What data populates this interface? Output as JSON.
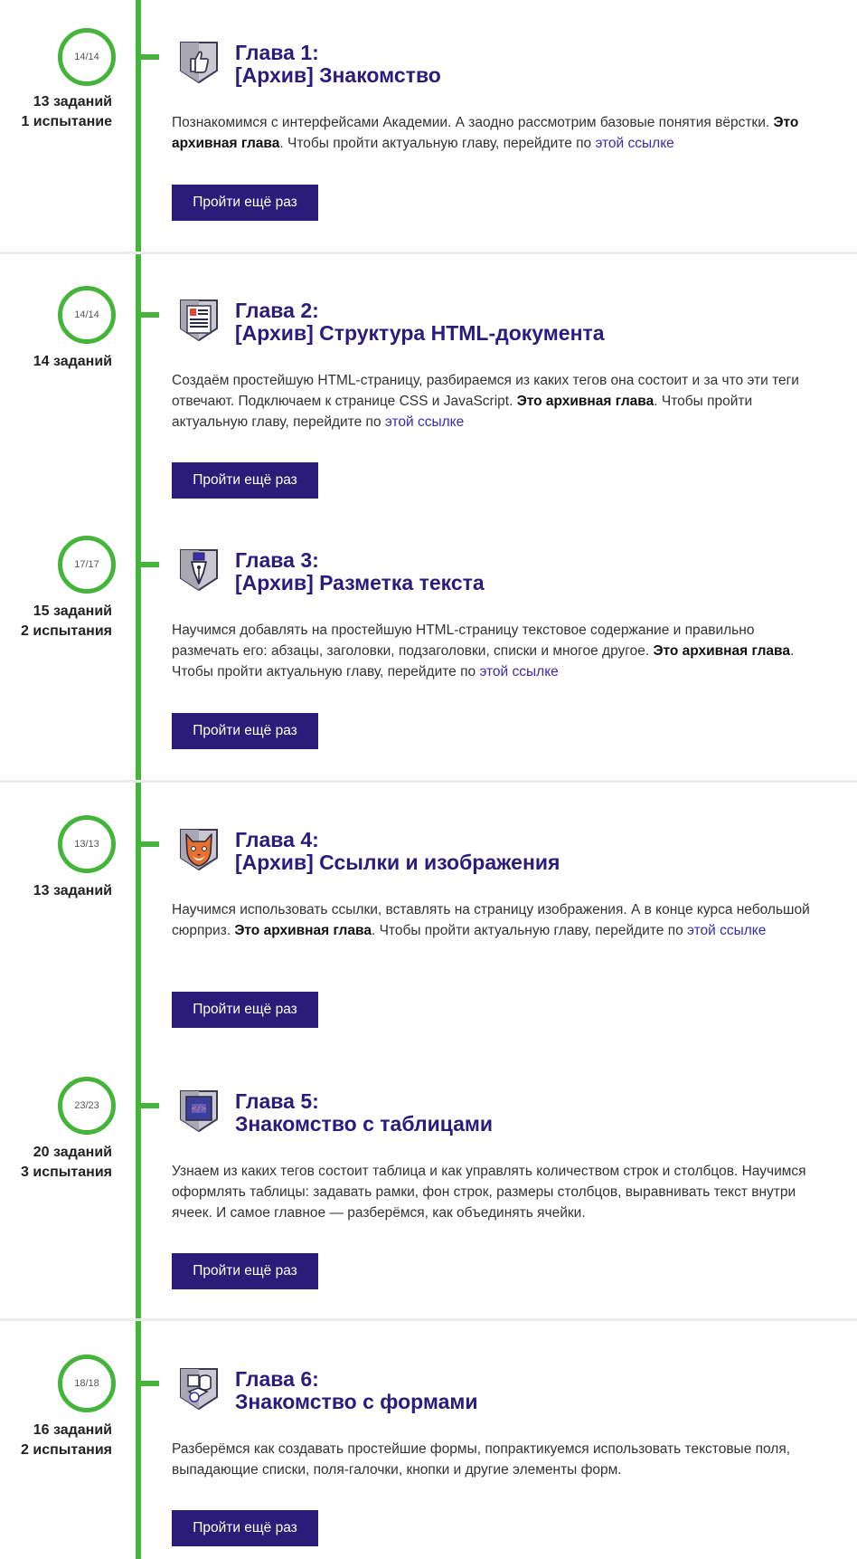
{
  "colors": {
    "timeline": "#45b43a",
    "title": "#2a1c7c",
    "button_bg": "#2c1c7a",
    "link": "#3b2bb3"
  },
  "chapters": [
    {
      "progress": "14/14",
      "tasks": "13 заданий",
      "trials": "1 испытание",
      "icon": "thumbs-up-shield-icon",
      "title_line1": "Глава 1:",
      "title_line2": "[Архив] Знакомство",
      "desc_text": "Познакомимся с интерфейсами Академии. А заодно рассмотрим базовые понятия вёрстки. ",
      "desc_bold": "Это архивная глава",
      "desc_after": ". Чтобы пройти актуальную главу, перейдите по ",
      "link_text": "этой ссылке",
      "button_label": "Пройти ещё раз"
    },
    {
      "progress": "14/14",
      "tasks": "14 заданий",
      "trials": "",
      "icon": "document-shield-icon",
      "title_line1": "Глава 2:",
      "title_line2": "[Архив] Структура HTML-документа",
      "desc_text": "Создаём простейшую HTML-страницу, разбираемся из каких тегов она состоит и за что эти теги отвечают. Подключаем к странице CSS и JavaScript. ",
      "desc_bold": "Это архивная глава",
      "desc_after": ". Чтобы пройти актуальную главу, перейдите по ",
      "link_text": "этой ссылке",
      "button_label": "Пройти ещё раз"
    },
    {
      "progress": "17/17",
      "tasks": "15 заданий",
      "trials": "2 испытания",
      "icon": "pen-nib-shield-icon",
      "title_line1": "Глава 3:",
      "title_line2": "[Архив] Разметка текста",
      "desc_text": "Научимся добавлять на простейшую HTML-страницу текстовое содержание и правильно размечать его: абзацы, заголовки, подзаголовки, списки и многое другое. ",
      "desc_bold": "Это архивная глава",
      "desc_after": ". Чтобы пройти актуальную главу, перейдите по ",
      "link_text": "этой ссылке",
      "button_label": "Пройти ещё раз"
    },
    {
      "progress": "13/13",
      "tasks": "13 заданий",
      "trials": "",
      "icon": "cat-shield-icon",
      "title_line1": "Глава 4:",
      "title_line2": "[Архив] Ссылки и изображения",
      "desc_text": "Научимся использовать ссылки, вставлять на страницу изображения. А в конце курса небольшой сюрприз. ",
      "desc_bold": "Это архивная глава",
      "desc_after": ". Чтобы пройти актуальную главу, перейдите по ",
      "link_text": "этой ссылке",
      "button_label": "Пройти ещё раз"
    },
    {
      "progress": "23/23",
      "tasks": "20 заданий",
      "trials": "3 испытания",
      "icon": "code-tag-shield-icon",
      "title_line1": "Глава 5:",
      "title_line2": "Знакомство с таблицами",
      "desc_text": "Узнаем из каких тегов состоит таблица и как управлять количеством строк и столбцов. Научимся оформлять таблицы: задавать рамки, фон строк, размеры столбцов, выравнивать текст внутри ячеек. И самое главное — разберёмся, как объединять ячейки.",
      "desc_bold": "",
      "desc_after": "",
      "link_text": "",
      "button_label": "Пройти ещё раз"
    },
    {
      "progress": "18/18",
      "tasks": "16 заданий",
      "trials": "2 испытания",
      "icon": "shapes-shield-icon",
      "title_line1": "Глава 6:",
      "title_line2": "Знакомство с формами",
      "desc_text": "Разберёмся как создавать простейшие формы, попрактикуемся использовать текстовые поля, выпадающие списки, поля-галочки, кнопки и другие элементы форм.",
      "desc_bold": "",
      "desc_after": "",
      "link_text": "",
      "button_label": "Пройти ещё раз"
    }
  ]
}
